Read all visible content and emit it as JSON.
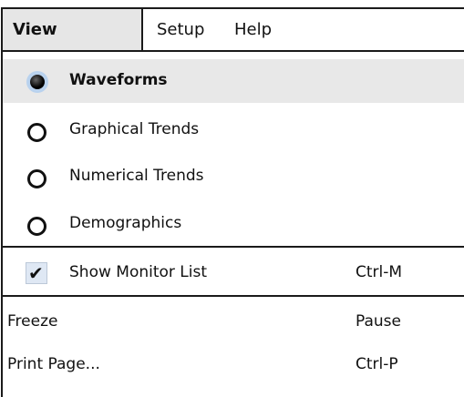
{
  "menubar": {
    "items": [
      {
        "label": "View",
        "active": true
      },
      {
        "label": "Setup"
      },
      {
        "label": "Help"
      }
    ]
  },
  "view_menu": {
    "radio_items": [
      {
        "label": "Waveforms",
        "selected": true
      },
      {
        "label": "Graphical Trends",
        "selected": false
      },
      {
        "label": "Numerical Trends",
        "selected": false
      },
      {
        "label": "Demographics",
        "selected": false
      }
    ],
    "check_items": [
      {
        "label": "Show Monitor List",
        "checked": true,
        "shortcut": "Ctrl-M"
      }
    ],
    "command_items": [
      {
        "label": "Freeze",
        "shortcut": "Pause"
      },
      {
        "label": "Print Page...",
        "shortcut": "Ctrl-P"
      }
    ]
  }
}
